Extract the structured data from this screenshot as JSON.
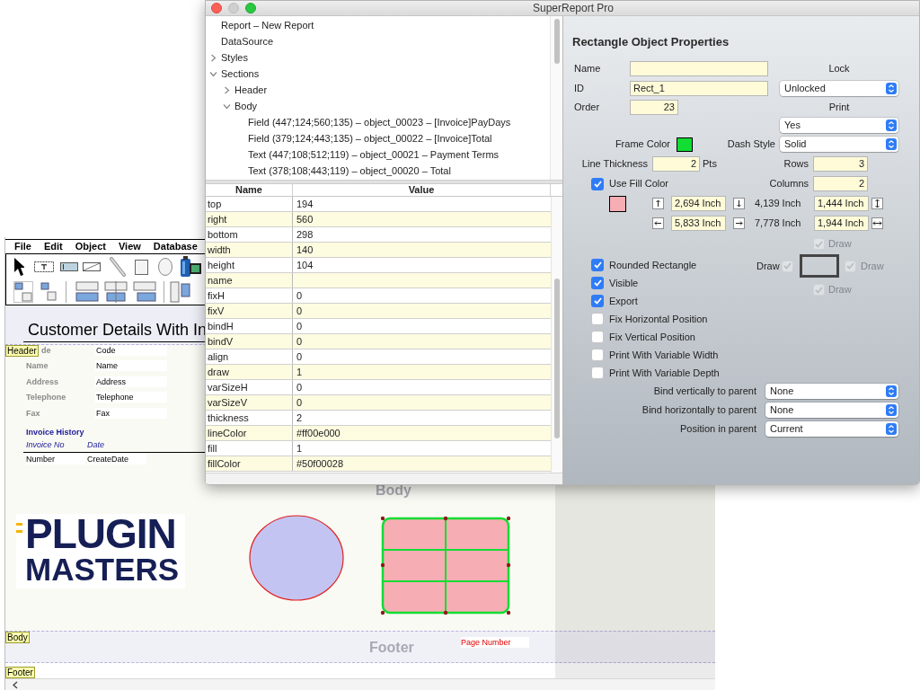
{
  "report_designer": {
    "menu": [
      "File",
      "Edit",
      "Object",
      "View",
      "Database"
    ],
    "report_title": "Customer Details With In",
    "section_tags": [
      "Header",
      "Body",
      "Footer"
    ],
    "header_fields": [
      {
        "label": "de",
        "value": "Code"
      },
      {
        "label": "Name",
        "value": "Name"
      },
      {
        "label": "Address",
        "value": "Address"
      },
      {
        "label": "Telephone",
        "value": "Telephone"
      },
      {
        "label": "Fax",
        "value": "Fax"
      }
    ],
    "invoice_history": {
      "title": "Invoice History",
      "columns": [
        "Invoice No",
        "Date"
      ],
      "row": [
        "Number",
        "CreateDate"
      ]
    },
    "section_titles": [
      "Body",
      "Footer"
    ],
    "logo": [
      "PLUGIN",
      "MASTERS"
    ],
    "page_number": "Page Number"
  },
  "window": {
    "title": "SuperReport Pro"
  },
  "tree": [
    {
      "label": "Report – New Report"
    },
    {
      "label": "DataSource"
    },
    {
      "label": "Styles",
      "expanded": false
    },
    {
      "label": "Sections",
      "expanded": true,
      "children": [
        {
          "label": "Header",
          "expanded": false
        },
        {
          "label": "Body",
          "expanded": true,
          "children": [
            {
              "label": "Field (447;124;560;135) – object_00023 – [Invoice]PayDays"
            },
            {
              "label": "Field (379;124;443;135) – object_00022 – [Invoice]Total"
            },
            {
              "label": "Text (447;108;512;119) – object_00021 – Payment Terms"
            },
            {
              "label": "Text (378;108;443;119) – object_00020 – Total"
            }
          ]
        }
      ]
    }
  ],
  "properties_table": {
    "columns": [
      "Name",
      "Value"
    ],
    "rows": [
      {
        "name": "top",
        "value": "194"
      },
      {
        "name": "right",
        "value": "560"
      },
      {
        "name": "bottom",
        "value": "298"
      },
      {
        "name": "width",
        "value": "140"
      },
      {
        "name": "height",
        "value": "104"
      },
      {
        "name": "name"
      },
      {
        "name": "fixH",
        "value": "0"
      },
      {
        "name": "fixV",
        "value": "0"
      },
      {
        "name": "bindH",
        "value": "0"
      },
      {
        "name": "bindV",
        "value": "0"
      },
      {
        "name": "align",
        "value": "0"
      },
      {
        "name": "draw",
        "value": "1"
      },
      {
        "name": "varSizeH",
        "value": "0"
      },
      {
        "name": "varSizeV",
        "value": "0"
      },
      {
        "name": "thickness",
        "value": "2"
      },
      {
        "name": "lineColor",
        "value": "#ff00e000"
      },
      {
        "name": "fill",
        "value": "1"
      },
      {
        "name": "fillColor",
        "value": "#50f00028"
      }
    ]
  },
  "inspector": {
    "title": "Rectangle Object Properties",
    "name": {
      "label": "Name"
    },
    "id": {
      "label": "ID",
      "value": "Rect_1"
    },
    "order": {
      "label": "Order",
      "value": "23"
    },
    "lock": {
      "label": "Lock",
      "value": "Unlocked"
    },
    "print": {
      "label": "Print",
      "value": "Yes"
    },
    "frame_color": {
      "label": "Frame Color",
      "color": "#11dd33"
    },
    "dash_style": {
      "label": "Dash Style",
      "value": "Solid"
    },
    "line_thickness": {
      "label": "Line Thickness",
      "value": "2",
      "unit": "Pts"
    },
    "rows": {
      "label": "Rows",
      "value": "3"
    },
    "columns": {
      "label": "Columns",
      "value": "2"
    },
    "use_fill_color": {
      "label": "Use Fill Color",
      "checked": true,
      "color": "#f7adb4"
    },
    "position": {
      "top": "2,694 Inch",
      "bottom": "4,139 Inch",
      "height": "1,444 Inch",
      "left": "5,833 Inch",
      "right": "7,778 Inch",
      "width": "1,944 Inch"
    },
    "border_draw": [
      {
        "kind": "top",
        "label": "Draw",
        "checked": true,
        "disabled": true
      },
      {
        "kind": "left",
        "label": "Draw",
        "checked": true,
        "disabled": true
      },
      {
        "kind": "right",
        "label": "Draw",
        "checked": true,
        "disabled": true
      },
      {
        "kind": "bottom",
        "label": "Draw",
        "checked": true,
        "disabled": true
      }
    ],
    "options": [
      {
        "label": "Rounded Rectangle",
        "checked": true
      },
      {
        "label": "Visible",
        "checked": true
      },
      {
        "label": "Export",
        "checked": true
      },
      {
        "label": "Fix Horizontal Position",
        "checked": false
      },
      {
        "label": "Fix Vertical Position",
        "checked": false
      },
      {
        "label": "Print With Variable Width",
        "checked": false
      },
      {
        "label": "Print With Variable Depth",
        "checked": false
      }
    ],
    "bindings": [
      {
        "label": "Bind vertically to parent",
        "value": "None"
      },
      {
        "label": "Bind horizontally to parent",
        "value": "None"
      },
      {
        "label": "Position in parent",
        "value": "Current"
      }
    ]
  }
}
